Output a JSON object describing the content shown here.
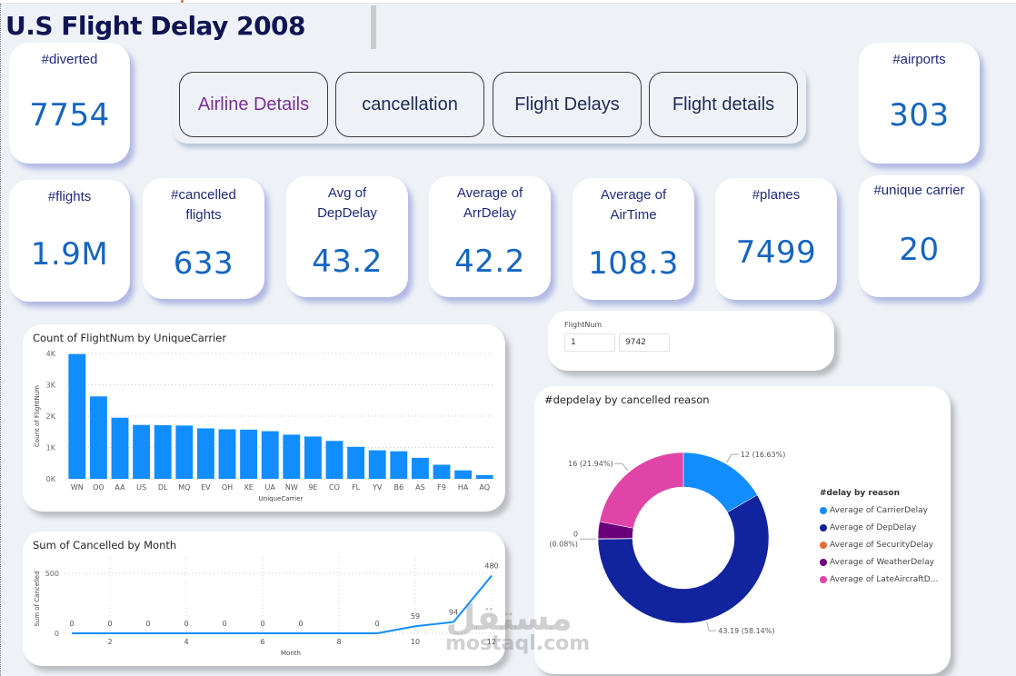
{
  "page": {
    "title": "U.S Flight Delay 2008"
  },
  "kpis": {
    "diverted": {
      "label": "#diverted",
      "value": "7754"
    },
    "airports": {
      "label": "#airports",
      "value": "303"
    },
    "flights": {
      "label": "#flights",
      "value": "1.9M"
    },
    "cancelled": {
      "label": "#cancelled flights",
      "value": "633"
    },
    "dep_delay": {
      "label": "Avg of DepDelay",
      "value": "43.2"
    },
    "arr_delay": {
      "label": "Average of ArrDelay",
      "value": "42.2"
    },
    "air_time": {
      "label": "Average of AirTime",
      "value": "108.3"
    },
    "planes": {
      "label": "#planes",
      "value": "7499"
    },
    "unique_carrier": {
      "label": "#unique carrier",
      "value": "20"
    }
  },
  "nav": {
    "buttons": [
      {
        "label": "Airline Details",
        "active": true
      },
      {
        "label": "cancellation",
        "active": false
      },
      {
        "label": "Flight Delays",
        "active": false
      },
      {
        "label": "Flight details",
        "active": false
      }
    ],
    "active_color": "#7b2f93"
  },
  "slicer": {
    "label": "FlightNum",
    "min": "1",
    "max": "9742"
  },
  "watermark": {
    "arabic": "مستقل",
    "latin": "mostaql.com"
  },
  "colors": {
    "kpi_value": "#1565c0",
    "kpi_label": "#1f2a7a",
    "title": "#0f1453",
    "bar": "#118dff",
    "line": "#118dff"
  },
  "chart_data": [
    {
      "type": "bar",
      "title": "Count of FlightNum by UniqueCarrier",
      "xlabel": "UniqueCarrier",
      "ylabel": "Count of FlightNum",
      "ylim": [
        0,
        4000
      ],
      "yticks": [
        0,
        1000,
        2000,
        3000,
        4000
      ],
      "ytick_labels": [
        "0K",
        "1K",
        "2K",
        "3K",
        "4K"
      ],
      "grid": true,
      "categories": [
        "WN",
        "OO",
        "AA",
        "US",
        "DL",
        "MQ",
        "EV",
        "OH",
        "XE",
        "UA",
        "NW",
        "9E",
        "CO",
        "FL",
        "YV",
        "B6",
        "AS",
        "F9",
        "HA",
        "AQ"
      ],
      "values": [
        3980,
        2630,
        1950,
        1720,
        1710,
        1700,
        1610,
        1580,
        1570,
        1520,
        1410,
        1350,
        1210,
        1020,
        910,
        880,
        670,
        450,
        270,
        120
      ]
    },
    {
      "type": "line",
      "title": "Sum of Cancelled by Month",
      "xlabel": "Month",
      "ylabel": "Sum of Cancelled",
      "xlim": [
        1,
        12
      ],
      "xticks": [
        2,
        4,
        6,
        8,
        10,
        12
      ],
      "ylim": [
        0,
        500
      ],
      "yticks": [
        0,
        500
      ],
      "grid": true,
      "x": [
        1,
        2,
        3,
        4,
        5,
        6,
        7,
        9,
        10,
        11,
        12
      ],
      "values": [
        0,
        0,
        0,
        0,
        0,
        0,
        0,
        0,
        59,
        94,
        480
      ],
      "labels": [
        "0",
        "0",
        "0",
        "0",
        "0",
        "0",
        "0",
        "0",
        "59",
        "94",
        "480"
      ]
    },
    {
      "type": "pie",
      "donut": true,
      "title": "#depdelay by cancelled reason",
      "legend_title": "#delay by reason",
      "legend_position": "right",
      "slices": [
        {
          "name": "Average of CarrierDelay",
          "value": 12,
          "percent": 16.63,
          "label": "12 (16.63%)",
          "color": "#118dff"
        },
        {
          "name": "Average of DepDelay",
          "value": 43.19,
          "percent": 58.14,
          "label": "43.19 (58.14%)",
          "color": "#12239e"
        },
        {
          "name": "Average of SecurityDelay",
          "value": 0,
          "percent": 0.08,
          "label": "0 (0.08%)",
          "color": "#e66c37"
        },
        {
          "name": "Average of WeatherDelay",
          "value": null,
          "percent": 3.21,
          "label": "",
          "color": "#6b007b"
        },
        {
          "name": "Average of LateAircraftD...",
          "value": 16,
          "percent": 21.94,
          "label": "16 (21.94%)",
          "color": "#e044a7"
        }
      ]
    }
  ]
}
